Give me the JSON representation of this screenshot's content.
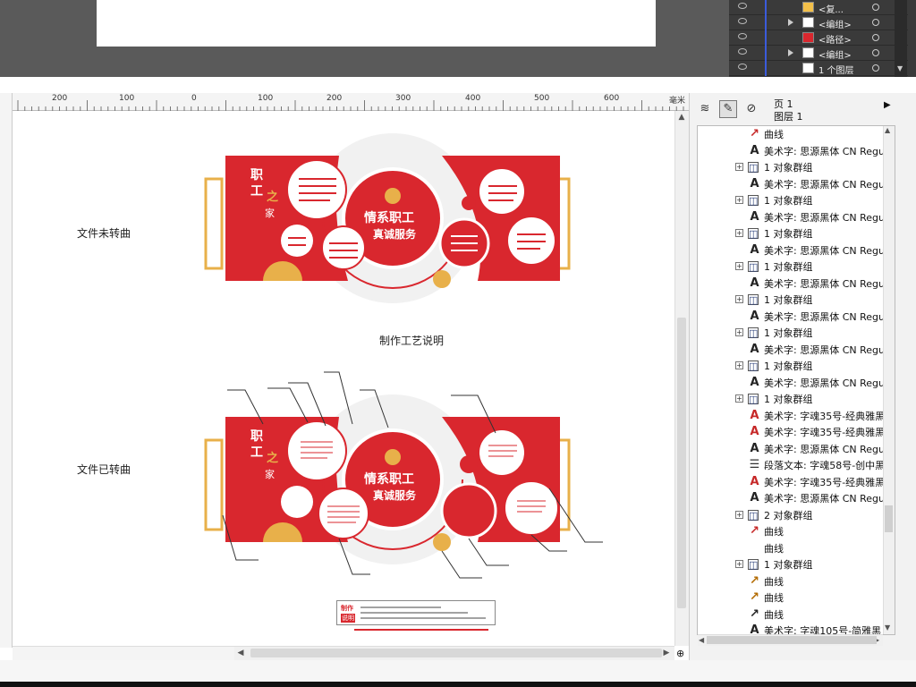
{
  "top_layers": [
    {
      "label": "<复...",
      "thumb_color": "#f3c04a",
      "expanded": false
    },
    {
      "label": "<编组>",
      "thumb_color": "#ffffff",
      "expanded": true
    },
    {
      "label": "<路径>",
      "thumb_color": "#d9272e",
      "expanded": false
    },
    {
      "label": "<编组>",
      "thumb_color": "#ffffff",
      "expanded": true
    },
    {
      "label": "1 个图层",
      "thumb_color": "#ffffff",
      "expanded": false
    }
  ],
  "ruler": {
    "unit": "毫米",
    "ticks": [
      "200",
      "100",
      "0",
      "100",
      "200",
      "300",
      "400",
      "500",
      "600"
    ]
  },
  "canvas": {
    "label_unconverted": "文件未转曲",
    "label_converted": "文件已转曲",
    "process_title": "制作工艺说明",
    "wall_title_left_1": "职",
    "wall_title_left_2": "工",
    "wall_title_left_3": "之",
    "wall_title_left_4": "家",
    "slogan_line1": "情系职工",
    "slogan_line2": "真诚服务",
    "note_label_1": "制作",
    "note_label_2": "说明"
  },
  "panel": {
    "page": "页 1",
    "layer": "图层 1",
    "tools": [
      "layer-props",
      "edit-across-layers",
      "layer-manager"
    ],
    "rows": [
      {
        "indent": 1,
        "type": "curve",
        "color": "red",
        "text": "曲线",
        "plus": false
      },
      {
        "indent": 1,
        "type": "art-text",
        "color": "black",
        "text": "美术字: 思源黑体 CN Regul",
        "plus": false
      },
      {
        "indent": 0,
        "type": "group",
        "text": "1 对象群组",
        "plus": true
      },
      {
        "indent": 1,
        "type": "art-text",
        "color": "black",
        "text": "美术字: 思源黑体 CN Regul",
        "plus": false
      },
      {
        "indent": 0,
        "type": "group",
        "text": "1 对象群组",
        "plus": true
      },
      {
        "indent": 1,
        "type": "art-text",
        "color": "black",
        "text": "美术字: 思源黑体 CN Regul",
        "plus": false
      },
      {
        "indent": 0,
        "type": "group",
        "text": "1 对象群组",
        "plus": true
      },
      {
        "indent": 1,
        "type": "art-text",
        "color": "black",
        "text": "美术字: 思源黑体 CN Regul",
        "plus": false
      },
      {
        "indent": 0,
        "type": "group",
        "text": "1 对象群组",
        "plus": true
      },
      {
        "indent": 1,
        "type": "art-text",
        "color": "black",
        "text": "美术字: 思源黑体 CN Regul",
        "plus": false
      },
      {
        "indent": 0,
        "type": "group",
        "text": "1 对象群组",
        "plus": true
      },
      {
        "indent": 1,
        "type": "art-text",
        "color": "black",
        "text": "美术字: 思源黑体 CN Regul",
        "plus": false
      },
      {
        "indent": 0,
        "type": "group",
        "text": "1 对象群组",
        "plus": true
      },
      {
        "indent": 1,
        "type": "art-text",
        "color": "black",
        "text": "美术字: 思源黑体 CN Regul",
        "plus": false
      },
      {
        "indent": 0,
        "type": "group",
        "text": "1 对象群组",
        "plus": true
      },
      {
        "indent": 1,
        "type": "art-text",
        "color": "black",
        "text": "美术字: 思源黑体 CN Regul",
        "plus": false
      },
      {
        "indent": 0,
        "type": "group",
        "text": "1 对象群组",
        "plus": true
      },
      {
        "indent": 1,
        "type": "art-text",
        "color": "red",
        "text": "美术字: 字魂35号-经典雅黑",
        "plus": false
      },
      {
        "indent": 1,
        "type": "art-text",
        "color": "red",
        "text": "美术字: 字魂35号-经典雅黑",
        "plus": false
      },
      {
        "indent": 1,
        "type": "art-text",
        "color": "black",
        "text": "美术字: 思源黑体 CN Regul",
        "plus": false
      },
      {
        "indent": 1,
        "type": "paragraph",
        "color": "black",
        "text": "段落文本: 字魂58号-创中黑",
        "plus": false
      },
      {
        "indent": 1,
        "type": "art-text",
        "color": "red",
        "text": "美术字: 字魂35号-经典雅黑",
        "plus": false
      },
      {
        "indent": 1,
        "type": "art-text",
        "color": "black",
        "text": "美术字: 思源黑体 CN Regul",
        "plus": false
      },
      {
        "indent": 0,
        "type": "group",
        "text": "2 对象群组",
        "plus": true
      },
      {
        "indent": 1,
        "type": "curve",
        "color": "red",
        "text": "曲线",
        "plus": false
      },
      {
        "indent": 1,
        "type": "curve-none",
        "color": "none",
        "text": "曲线",
        "plus": false
      },
      {
        "indent": 0,
        "type": "group",
        "text": "1 对象群组",
        "plus": true
      },
      {
        "indent": 1,
        "type": "curve",
        "color": "orange",
        "text": "曲线",
        "plus": false
      },
      {
        "indent": 1,
        "type": "curve",
        "color": "orange",
        "text": "曲线",
        "plus": false
      },
      {
        "indent": 1,
        "type": "curve",
        "color": "black",
        "text": "曲线",
        "plus": false
      },
      {
        "indent": 1,
        "type": "art-text",
        "color": "black",
        "text": "美术字: 字魂105号-简雅黑 (",
        "plus": false
      }
    ]
  },
  "colors": {
    "wall_red": "#d9272e",
    "gold": "#e8b04a",
    "light_gray": "#efefef"
  }
}
